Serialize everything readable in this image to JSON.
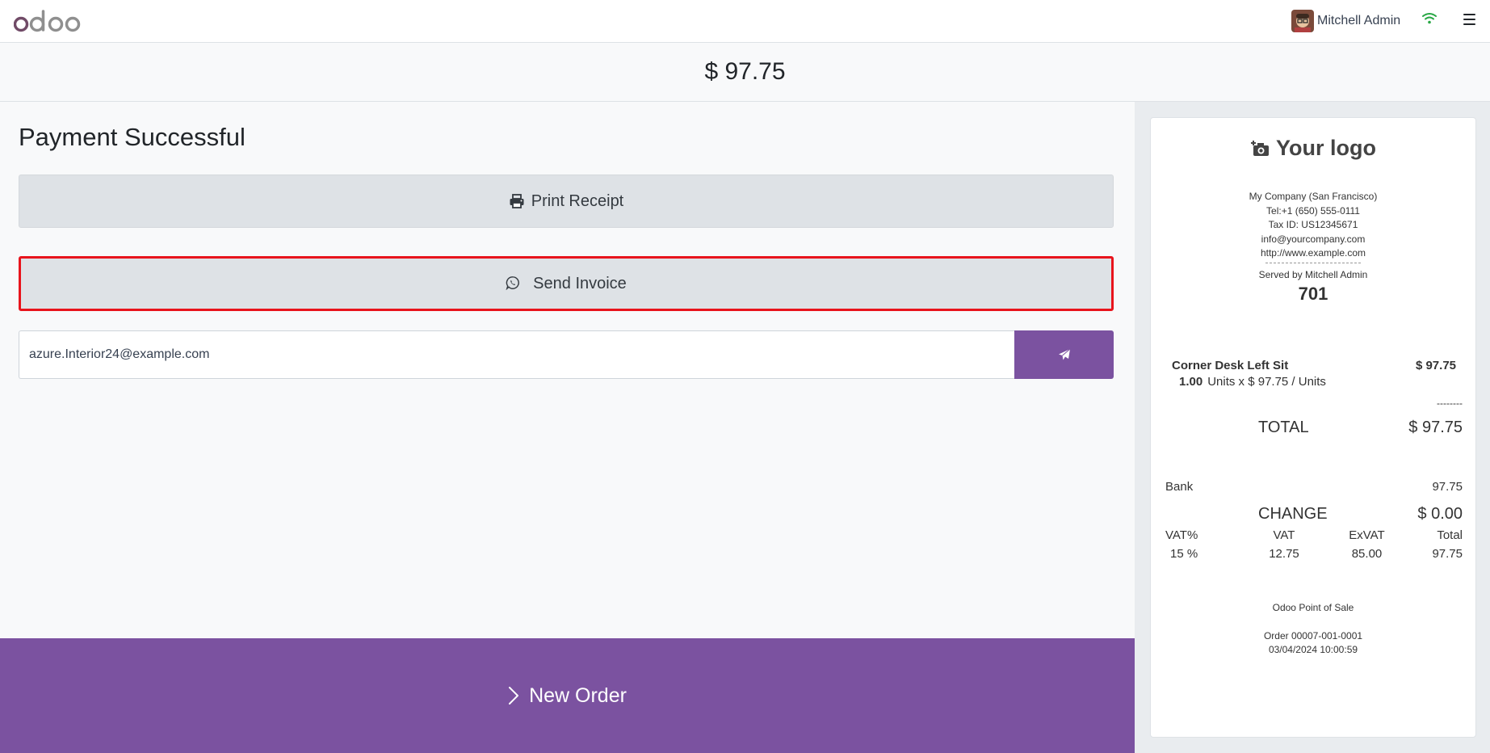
{
  "header": {
    "brand": "odoo",
    "user_name": "Mitchell Admin",
    "icons": [
      "odoo-logo",
      "avatar",
      "wifi-icon",
      "hamburger-menu-icon"
    ]
  },
  "amount_due": "$ 97.75",
  "payment": {
    "title": "Payment Successful",
    "print_receipt_label": "Print Receipt",
    "send_invoice_label": "Send Invoice",
    "email_value": "azure.Interior24@example.com",
    "send_icon": "paper-plane-icon",
    "new_order_label": "New Order"
  },
  "colors": {
    "accent": "#7b52a0",
    "highlight_border": "#e8141c",
    "button_bg": "#dee2e6"
  },
  "receipt": {
    "logo_text": "Your logo",
    "company": "My Company (San Francisco)",
    "tel": "Tel:+1 (650) 555-0111",
    "tax_id": "Tax ID: US12345671",
    "email": "info@yourcompany.com",
    "website": "http://www.example.com",
    "served_by": "Served by Mitchell Admin",
    "order_number": "701",
    "line": {
      "product": "Corner Desk Left Sit",
      "price": "$ 97.75",
      "qty": "1.00",
      "unit_detail": "Units x $ 97.75 / Units"
    },
    "dashes": "--------",
    "total_label": "TOTAL",
    "total_value": "$ 97.75",
    "payment_method": "Bank",
    "payment_amount": "97.75",
    "change_label": "CHANGE",
    "change_value": "$ 0.00",
    "tax_headers": [
      "VAT%",
      "VAT",
      "ExVAT",
      "Total"
    ],
    "tax_values": [
      "15 %",
      "12.75",
      "85.00",
      "97.75"
    ],
    "footer_pos": "Odoo Point of Sale",
    "order_ref": "Order 00007-001-0001",
    "datetime": "03/04/2024 10:00:59"
  }
}
